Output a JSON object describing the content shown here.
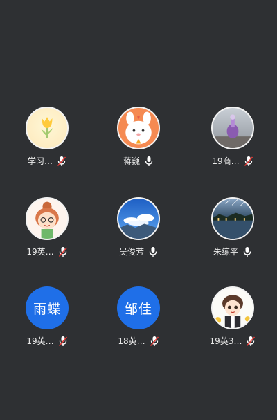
{
  "colors": {
    "background": "#2e3033",
    "name_text": "#e9e9e9",
    "text_avatar_bg": "#1f6fe8",
    "mic_on": "#ffffff",
    "mic_muted": "#ffffff",
    "mic_muted_slash": "#e53935"
  },
  "participants": [
    {
      "name": "学习…",
      "avatar_icon": "tulip-icon",
      "mic": "muted"
    },
    {
      "name": "蒋巍",
      "avatar_icon": "cartoon-bunny-icon",
      "mic": "on"
    },
    {
      "name": "19商…",
      "avatar_icon": "photo-vase-icon",
      "mic": "muted"
    },
    {
      "name": "19英…",
      "avatar_icon": "cartoon-girl-icon",
      "mic": "muted"
    },
    {
      "name": "吴俊芳",
      "avatar_icon": "blue-sky-photo-icon",
      "mic": "on"
    },
    {
      "name": "朱练平",
      "avatar_icon": "night-lake-photo-icon",
      "mic": "on"
    },
    {
      "name": "19英…",
      "avatar_text": "雨蝶",
      "mic": "muted"
    },
    {
      "name": "18英…",
      "avatar_text": "邹佳",
      "mic": "muted"
    },
    {
      "name": "19英3…",
      "avatar_icon": "cartoon-boy-icon",
      "mic": "muted"
    }
  ]
}
